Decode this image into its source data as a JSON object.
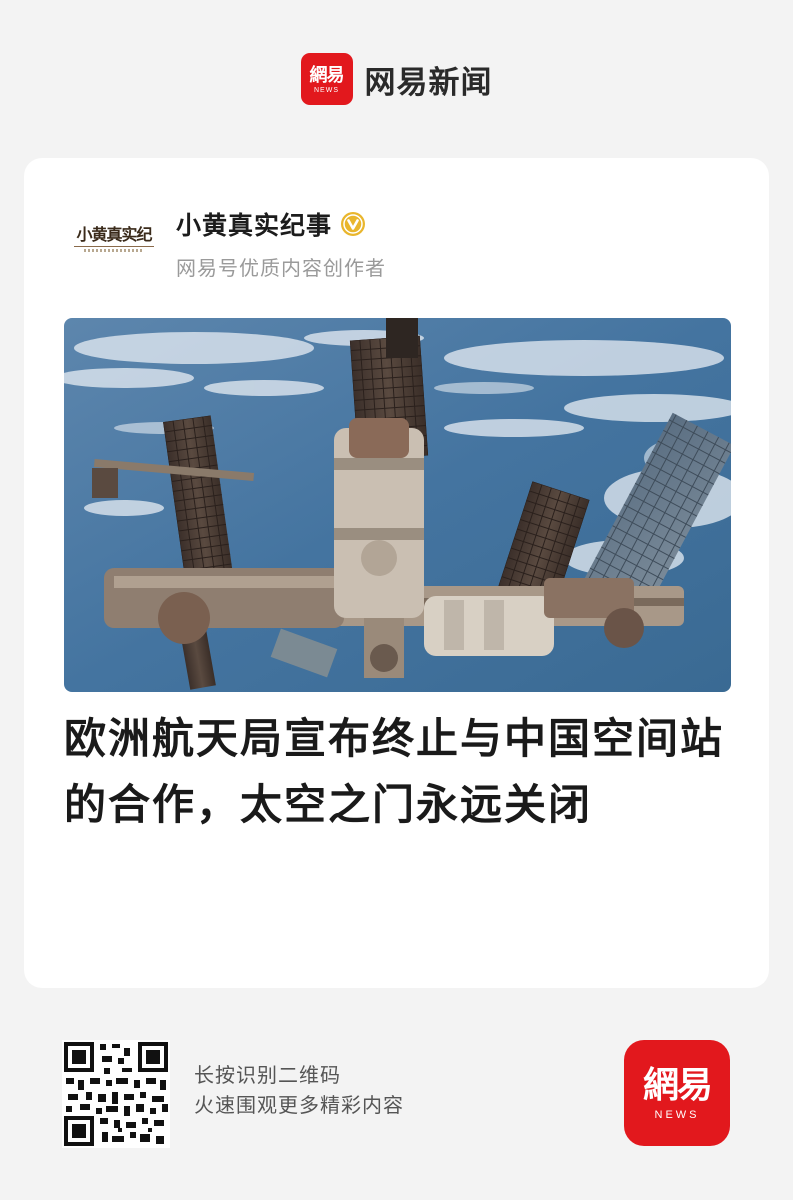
{
  "header": {
    "logo_cn": "網易",
    "logo_en": "NEWS",
    "app_name": "网易新闻"
  },
  "author": {
    "avatar_text": "小黄真实纪",
    "name": "小黄真实纪事",
    "subtitle": "网易号优质内容创作者",
    "verified_icon": "verified-v-icon"
  },
  "article": {
    "image_subject": "space-station-photo",
    "headline": "欧洲航天局宣布终止与中国空间站的合作，太空之门永远关闭"
  },
  "footer": {
    "line1": "长按识别二维码",
    "line2": "火速围观更多精彩内容",
    "logo_cn": "網易",
    "logo_en": "NEWS"
  },
  "colors": {
    "brand_red": "#e2181d",
    "badge_gold": "#e9b62d",
    "background": "#f3f3f3",
    "card": "#ffffff"
  }
}
